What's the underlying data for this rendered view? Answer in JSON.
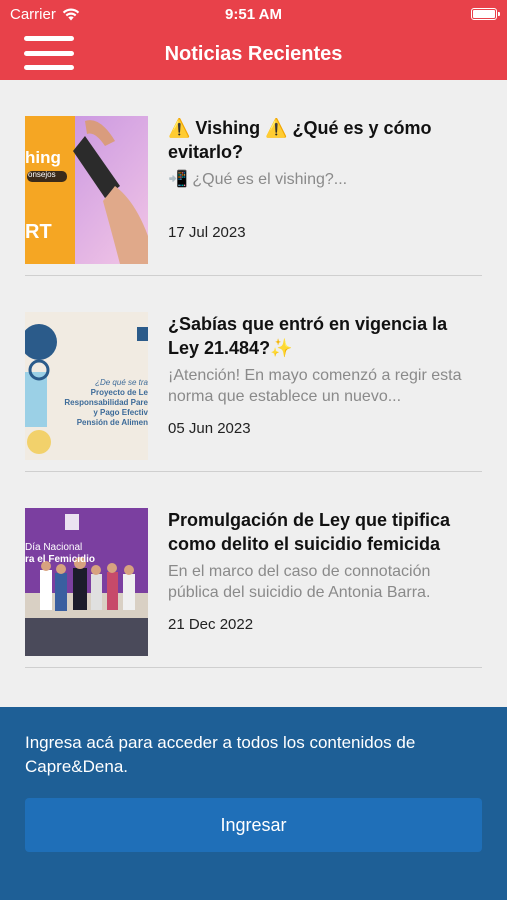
{
  "status_bar": {
    "carrier": "Carrier",
    "time": "9:51 AM"
  },
  "nav": {
    "title": "Noticias Recientes"
  },
  "news": [
    {
      "title": "⚠️ Vishing ⚠️ ¿Qué es y cómo evitarlo?",
      "desc": "📲 ¿Qué es el vishing?...",
      "date": "17 Jul 2023",
      "thumb_lines": [
        "hing",
        "onsejos",
        "RT"
      ]
    },
    {
      "title": "¿Sabías que entró en vigencia la Ley 21.484?✨",
      "desc": "¡Atención! En mayo comenzó a regir esta norma que establece un nuevo...",
      "date": "05 Jun 2023",
      "thumb_lines": [
        "¿De qué se tra",
        "Proyecto de Le",
        "Responsabilidad Pare",
        "y Pago Efectiv",
        "Pensión de Alimen"
      ]
    },
    {
      "title": "Promulgación de Ley que tipifica como delito el suicidio femicida",
      "desc": "En el marco del caso de connotación pública del suicidio de Antonia Barra.",
      "date": "21 Dec 2022",
      "thumb_lines": [
        "Día Nacional",
        "ra el Femicidio"
      ]
    }
  ],
  "login": {
    "message": "Ingresa acá para acceder a todos los contenidos de Capre&Dena.",
    "button": "Ingresar"
  },
  "colors": {
    "header": "#e8414a",
    "panel": "#1e5f96",
    "button": "#1f6fb8"
  }
}
